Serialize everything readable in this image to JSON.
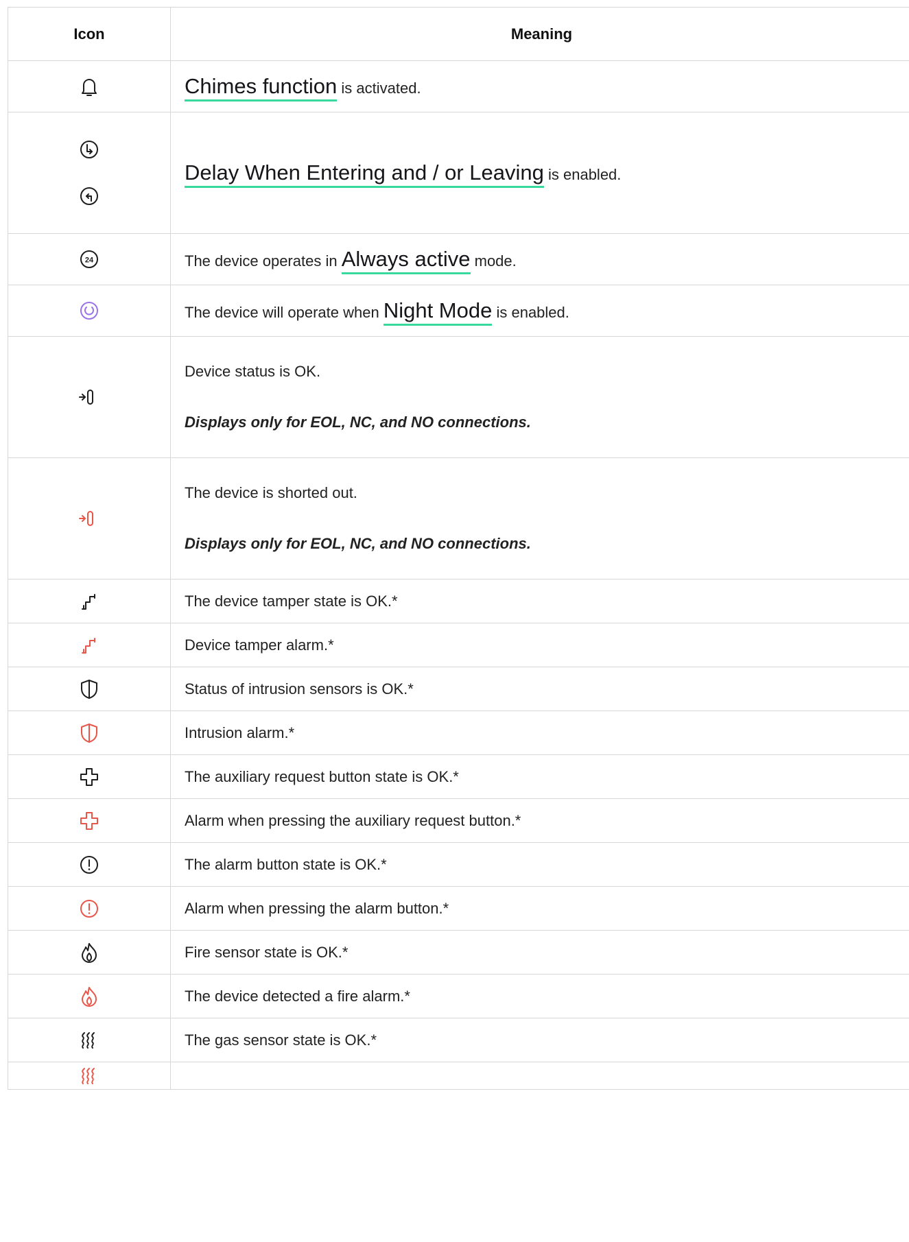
{
  "header": {
    "icon": "Icon",
    "meaning": "Meaning"
  },
  "colors": {
    "dark": "#1d1d1f",
    "red": "#e8564a",
    "purple": "#9a72ea",
    "accent": "#38d99d"
  },
  "rows": [
    {
      "pre": "",
      "link": "Chimes function",
      "post": " is activated.",
      "note": "",
      "icons": [
        "bell-icon"
      ],
      "color": "dark"
    },
    {
      "pre": "",
      "link": "Delay When Entering and / or Leaving",
      "post": " is enabled.",
      "note": "",
      "icons": [
        "delay-entering-icon",
        "delay-leaving-icon"
      ],
      "color": "dark"
    },
    {
      "pre": "The device operates in ",
      "link": "Always active",
      "post": " mode.",
      "note": "",
      "icons": [
        "always-active-24-icon"
      ],
      "color": "dark"
    },
    {
      "pre": "The device will operate when ",
      "link": "Night Mode",
      "post": " is enabled.",
      "note": "",
      "icons": [
        "night-mode-icon"
      ],
      "color": "purple"
    },
    {
      "pre": "Device status is OK.",
      "link": "",
      "post": "",
      "note": "Displays only for EOL, NC, and NO connections.",
      "icons": [
        "connection-icon"
      ],
      "color": "dark"
    },
    {
      "pre": "The device is shorted out.",
      "link": "",
      "post": "",
      "note": "Displays only for EOL, NC, and NO connections.",
      "icons": [
        "connection-short-icon"
      ],
      "color": "red"
    },
    {
      "pre": "The device tamper state is OK.*",
      "link": "",
      "post": "",
      "note": "",
      "icons": [
        "tamper-icon"
      ],
      "color": "dark"
    },
    {
      "pre": "Device tamper alarm.*",
      "link": "",
      "post": "",
      "note": "",
      "icons": [
        "tamper-alarm-icon"
      ],
      "color": "red"
    },
    {
      "pre": "Status of intrusion sensors is OK.*",
      "link": "",
      "post": "",
      "note": "",
      "icons": [
        "shield-icon"
      ],
      "color": "dark"
    },
    {
      "pre": "Intrusion alarm.*",
      "link": "",
      "post": "",
      "note": "",
      "icons": [
        "shield-alarm-icon"
      ],
      "color": "red"
    },
    {
      "pre": "The auxiliary request button state is OK.*",
      "link": "",
      "post": "",
      "note": "",
      "icons": [
        "cross-icon"
      ],
      "color": "dark"
    },
    {
      "pre": "Alarm when pressing the auxiliary request button.*",
      "link": "",
      "post": "",
      "note": "",
      "icons": [
        "cross-alarm-icon"
      ],
      "color": "red"
    },
    {
      "pre": "The alarm button state is OK.*",
      "link": "",
      "post": "",
      "note": "",
      "icons": [
        "exclamation-icon"
      ],
      "color": "dark"
    },
    {
      "pre": "Alarm when pressing the alarm button.*",
      "link": "",
      "post": "",
      "note": "",
      "icons": [
        "exclamation-alarm-icon"
      ],
      "color": "red"
    },
    {
      "pre": "Fire sensor state is OK.*",
      "link": "",
      "post": "",
      "note": "",
      "icons": [
        "flame-icon"
      ],
      "color": "dark"
    },
    {
      "pre": "The device detected a fire alarm.*",
      "link": "",
      "post": "",
      "note": "",
      "icons": [
        "flame-alarm-icon"
      ],
      "color": "red"
    },
    {
      "pre": "The gas sensor state is OK.*",
      "link": "",
      "post": "",
      "note": "",
      "icons": [
        "gas-icon"
      ],
      "color": "dark"
    },
    {
      "pre": "",
      "link": "",
      "post": "",
      "note": "",
      "icons": [
        "gas-alarm-icon"
      ],
      "color": "red"
    }
  ]
}
